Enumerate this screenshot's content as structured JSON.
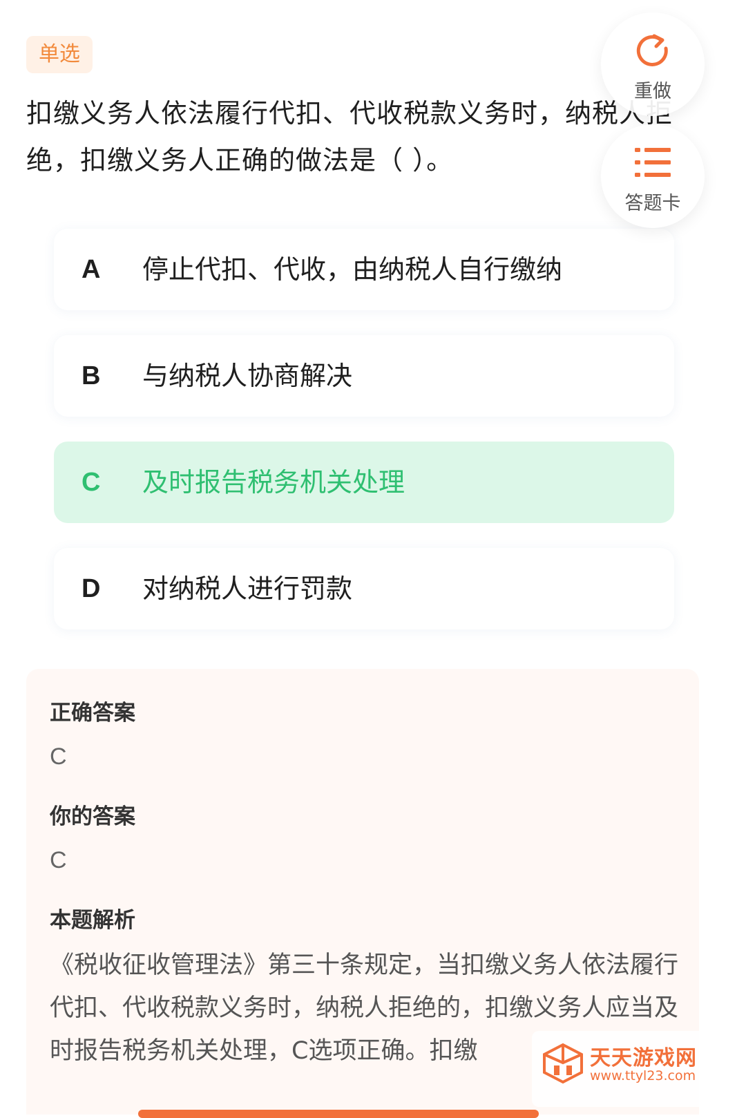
{
  "question": {
    "type_tag": "单选",
    "text": "扣缴义务人依法履行代扣、代收税款义务时，纳税人拒绝，扣缴义务人正确的做法是（ ）。"
  },
  "actions": {
    "redo_label": "重做",
    "answer_card_label": "答题卡",
    "accent_color": "#f2703a"
  },
  "options": [
    {
      "letter": "A",
      "text": "停止代扣、代收，由纳税人自行缴纳"
    },
    {
      "letter": "B",
      "text": "与纳税人协商解决"
    },
    {
      "letter": "C",
      "text": "及时报告税务机关处理"
    },
    {
      "letter": "D",
      "text": "对纳税人进行罚款"
    }
  ],
  "selected_option": "C",
  "correct_color": "#2fbf71",
  "analysis": {
    "correct_answer_title": "正确答案",
    "correct_answer": "C",
    "your_answer_title": "你的答案",
    "your_answer": "C",
    "explanation_title": "本题解析",
    "explanation": "《税收征收管理法》第三十条规定，当扣缴义务人依法履行代扣、代收税款义务时，纳税人拒绝的，扣缴义务人应当及时报告税务机关处理，C选项正确。扣缴"
  },
  "watermark": {
    "name": "天天游戏网",
    "url": "www.ttyl23.com"
  }
}
